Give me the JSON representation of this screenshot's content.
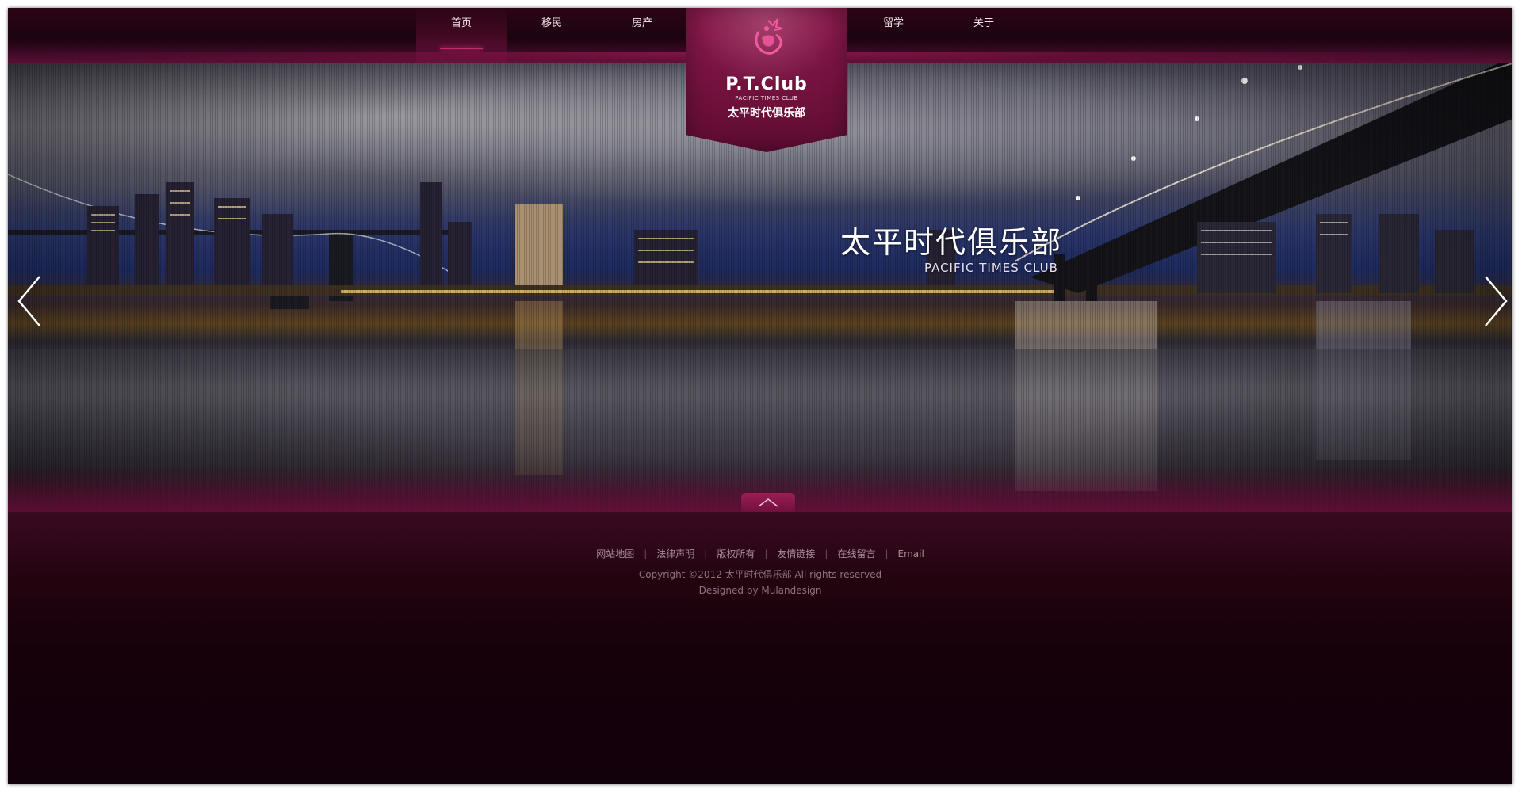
{
  "nav": {
    "left": [
      {
        "label": "首页",
        "active": true
      },
      {
        "label": "移民",
        "active": false
      },
      {
        "label": "房产",
        "active": false
      }
    ],
    "right": [
      {
        "label": "留学",
        "active": false
      },
      {
        "label": "关于",
        "active": false
      }
    ]
  },
  "logo": {
    "name": "P.T.Club",
    "sub": "PACIFIC TIMES CLUB",
    "cn": "太平时代俱乐部",
    "icon": "dragon-logo-icon"
  },
  "hero": {
    "title": "太平时代俱乐部",
    "subtitle": "PACIFIC TIMES CLUB",
    "prev_icon": "chevron-left-icon",
    "next_icon": "chevron-right-icon",
    "collapse_icon": "chevron-up-icon"
  },
  "footer": {
    "links": [
      "网站地图",
      "法律声明",
      "版权所有",
      "友情链接",
      "在线留言",
      "Email"
    ],
    "copyright": "Copyright ©2012 太平时代俱乐部 All rights reserved",
    "designed_by": "Designed by Mulandesign"
  },
  "colors": {
    "brand": "#7a1442",
    "accent": "#c42a70",
    "footer_bg": "#12000a"
  }
}
